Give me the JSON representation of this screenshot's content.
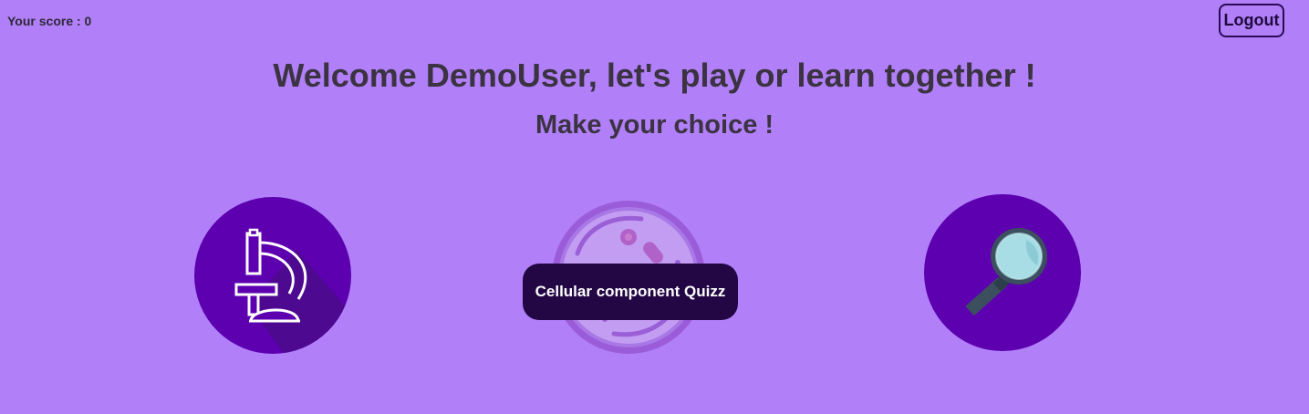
{
  "score": {
    "label": "Your score : 0"
  },
  "header": {
    "logout_label": "Logout"
  },
  "welcome": {
    "title": "Welcome DemoUser, let's play or learn together !",
    "subtitle": "Make your choice !"
  },
  "choices": [
    {
      "icon": "microscope-icon"
    },
    {
      "icon": "cell-icon",
      "button_label": "Cellular component Quizz"
    },
    {
      "icon": "magnifying-glass-icon"
    }
  ],
  "colors": {
    "background": "#b180f8",
    "circle": "#5d00b0",
    "button": "#230744"
  }
}
